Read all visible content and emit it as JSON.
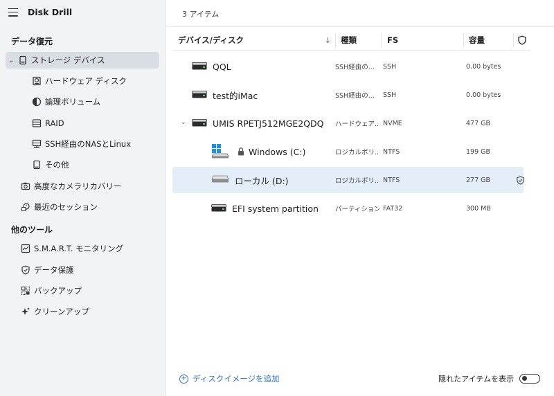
{
  "app": {
    "title": "Disk Drill"
  },
  "sidebar": {
    "section_recovery": "データ復元",
    "storage_devices": "ストレージ デバイス",
    "hardware_disk": "ハードウェア ディスク",
    "logical_volume": "論理ボリューム",
    "raid": "RAID",
    "ssh_nas": "SSH経由のNASとLinux",
    "other": "その他",
    "camera_recovery": "高度なカメラリカバリー",
    "recent_sessions": "最近のセッション",
    "section_tools": "他のツール",
    "smart": "S.M.A.R.T. モニタリング",
    "data_protection": "データ保護",
    "backup": "バックアップ",
    "cleanup": "クリーンアップ"
  },
  "main": {
    "item_count": "3 アイテム",
    "columns": {
      "device": "デバイス/ディスク",
      "type": "種類",
      "fs": "FS",
      "capacity": "容量"
    },
    "rows": [
      {
        "name": "QQL",
        "type": "SSH経由の...",
        "fs": "SSH",
        "size": "0.00 bytes"
      },
      {
        "name": "test的iMac",
        "type": "SSH経由の...",
        "fs": "SSH",
        "size": "0.00 bytes"
      },
      {
        "name": "UMIS RPETJ512MGE2QDQ",
        "type": "ハードウェア...",
        "fs": "NVME",
        "size": "477 GB"
      },
      {
        "name": "Windows (C:)",
        "type": "ロジカルボリ...",
        "fs": "NTFS",
        "size": "199 GB"
      },
      {
        "name": "ローカル (D:)",
        "type": "ロジカルボリ...",
        "fs": "NTFS",
        "size": "277 GB"
      },
      {
        "name": "EFI system partition",
        "type": "パーティション",
        "fs": "FAT32",
        "size": "300 MB"
      }
    ],
    "add_disk_image": "ディスクイメージを追加",
    "show_hidden": "隠れたアイテムを表示"
  },
  "colors": {
    "accent": "#2f6fd1",
    "selected_row": "#e3eef9",
    "sidebar_bg": "#f1f3f5"
  }
}
